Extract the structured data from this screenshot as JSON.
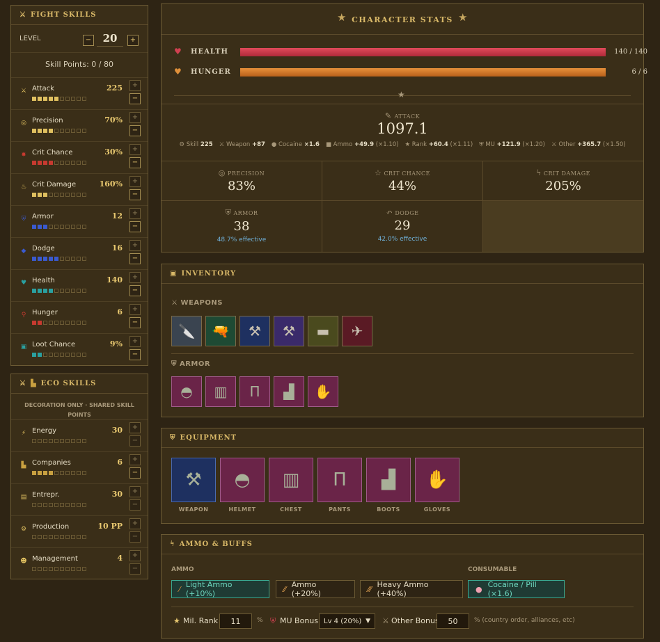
{
  "fight_skills": {
    "title": "FIGHT SKILLS",
    "level_label": "LEVEL",
    "level_value": "20",
    "skill_points": "Skill Points: 0 / 80",
    "skills": [
      {
        "name": "Attack",
        "value": "225",
        "icon": "sword-icon",
        "glyph": "⚔",
        "color": "#e0c060",
        "filled": 5
      },
      {
        "name": "Precision",
        "value": "70%",
        "icon": "target-icon",
        "glyph": "◎",
        "color": "#e0c060",
        "filled": 4
      },
      {
        "name": "Crit Chance",
        "value": "30%",
        "icon": "explosion-icon",
        "glyph": "✸",
        "color": "#c83a30",
        "filled": 4
      },
      {
        "name": "Crit Damage",
        "value": "160%",
        "icon": "fire-icon",
        "glyph": "♨",
        "color": "#e0c060",
        "filled": 3
      },
      {
        "name": "Armor",
        "value": "12",
        "icon": "shield-icon",
        "glyph": "⛨",
        "color": "#3a5ad0",
        "filled": 3
      },
      {
        "name": "Dodge",
        "value": "16",
        "icon": "diamond-icon",
        "glyph": "◆",
        "color": "#3a5ad0",
        "filled": 5
      },
      {
        "name": "Health",
        "value": "140",
        "icon": "heart-icon",
        "glyph": "♥",
        "color": "#2aa0a0",
        "filled": 4
      },
      {
        "name": "Hunger",
        "value": "6",
        "icon": "drumstick-icon",
        "glyph": "⚲",
        "color": "#c83a30",
        "filled": 2
      },
      {
        "name": "Loot Chance",
        "value": "9%",
        "icon": "bag-icon",
        "glyph": "▣",
        "color": "#2aa0a0",
        "filled": 2
      }
    ]
  },
  "eco_skills": {
    "title": "ECO SKILLS",
    "note": "DECORATION ONLY · SHARED SKILL POINTS",
    "skills": [
      {
        "name": "Energy",
        "value": "30",
        "icon": "lightning-icon",
        "glyph": "⚡",
        "color": "#e0c060",
        "filled": 0
      },
      {
        "name": "Companies",
        "value": "6",
        "icon": "factory-icon",
        "glyph": "▙",
        "color": "#c8a040",
        "filled": 4
      },
      {
        "name": "Entrepr.",
        "value": "30",
        "icon": "briefcase-icon",
        "glyph": "▤",
        "color": "#e0c060",
        "filled": 0
      },
      {
        "name": "Production",
        "value": "10 PP",
        "icon": "gear-icon",
        "glyph": "⚙",
        "color": "#e0c060",
        "filled": 0
      },
      {
        "name": "Management",
        "value": "4",
        "icon": "people-icon",
        "glyph": "☻",
        "color": "#e0c060",
        "filled": 0
      }
    ]
  },
  "stats": {
    "title": "CHARACTER STATS",
    "health_label": "HEALTH",
    "health_value": "140 / 140",
    "health_fill": 1.0,
    "hunger_label": "HUNGER",
    "hunger_value": "6 / 6",
    "hunger_fill": 1.0,
    "attack_label": "ATTACK",
    "attack_value": "1097.1",
    "breakdown": [
      {
        "icon": "skill-icon",
        "glyph": "⚙",
        "label": "Skill",
        "val": "225",
        "mult": ""
      },
      {
        "icon": "weapon-icon",
        "glyph": "⚔",
        "label": "Weapon",
        "val": "+87",
        "mult": ""
      },
      {
        "icon": "pill-icon",
        "glyph": "●",
        "label": "Cocaine",
        "val": "×1.6",
        "mult": ""
      },
      {
        "icon": "ammo-icon",
        "glyph": "■",
        "label": "Ammo",
        "val": "+49.9",
        "mult": "(×1.10)"
      },
      {
        "icon": "star-icon",
        "glyph": "★",
        "label": "Rank",
        "val": "+60.4",
        "mult": "(×1.11)"
      },
      {
        "icon": "shield-icon",
        "glyph": "⛨",
        "label": "MU",
        "val": "+121.9",
        "mult": "(×1.20)"
      },
      {
        "icon": "swords-icon",
        "glyph": "⚔",
        "label": "Other",
        "val": "+365.7",
        "mult": "(×1.50)"
      }
    ],
    "precision_label": "PRECISION",
    "precision_value": "83%",
    "crit_chance_label": "CRIT CHANCE",
    "crit_chance_value": "44%",
    "crit_damage_label": "CRIT DAMAGE",
    "crit_damage_value": "205%",
    "armor_label": "ARMOR",
    "armor_value": "38",
    "armor_eff": "48.7% effective",
    "dodge_label": "DODGE",
    "dodge_value": "29",
    "dodge_eff": "42.0% effective"
  },
  "inventory": {
    "title": "INVENTORY",
    "weapons_label": "WEAPONS",
    "weapons": [
      {
        "icon": "knife-icon",
        "glyph": "🔪",
        "bg": "#3a4450"
      },
      {
        "icon": "pistol-icon",
        "glyph": "🔫",
        "bg": "#1e4a34"
      },
      {
        "icon": "rifle-icon",
        "glyph": "⚒",
        "bg": "#1e3060"
      },
      {
        "icon": "sniper-icon",
        "glyph": "⚒",
        "bg": "#3a2a6a"
      },
      {
        "icon": "tank-icon",
        "glyph": "▬",
        "bg": "#4a4a1e"
      },
      {
        "icon": "jet-icon",
        "glyph": "✈",
        "bg": "#5a1a24"
      }
    ],
    "armor_label": "ARMOR",
    "armor": [
      {
        "icon": "helmet-icon",
        "glyph": "◓"
      },
      {
        "icon": "vest-icon",
        "glyph": "▥"
      },
      {
        "icon": "pants-icon",
        "glyph": "Π"
      },
      {
        "icon": "boots-icon",
        "glyph": "▟"
      },
      {
        "icon": "gloves-icon",
        "glyph": "✋"
      }
    ]
  },
  "equipment": {
    "title": "EQUIPMENT",
    "slots": [
      {
        "label": "WEAPON",
        "icon": "rifle-icon",
        "glyph": "⚒"
      },
      {
        "label": "HELMET",
        "icon": "helmet-icon",
        "glyph": "◓"
      },
      {
        "label": "CHEST",
        "icon": "vest-icon",
        "glyph": "▥"
      },
      {
        "label": "PANTS",
        "icon": "pants-icon",
        "glyph": "Π"
      },
      {
        "label": "BOOTS",
        "icon": "boots-icon",
        "glyph": "▟"
      },
      {
        "label": "GLOVES",
        "icon": "gloves-icon",
        "glyph": "✋"
      }
    ]
  },
  "ammo": {
    "title": "AMMO & BUFFS",
    "ammo_label": "AMMO",
    "consumable_label": "CONSUMABLE",
    "light": "Light Ammo (+10%)",
    "normal": "Ammo (+20%)",
    "heavy": "Heavy Ammo (+40%)",
    "cocaine": "Cocaine / Pill (×1.6)",
    "mil_rank_label": "Mil. Rank",
    "mil_rank_value": "11",
    "pct": "%",
    "mu_bonus_label": "MU Bonus",
    "mu_bonus_value": "Lv 4 (20%)",
    "other_bonus_label": "Other Bonus",
    "other_bonus_value": "50",
    "other_note": "% (country order, alliances, etc)"
  }
}
